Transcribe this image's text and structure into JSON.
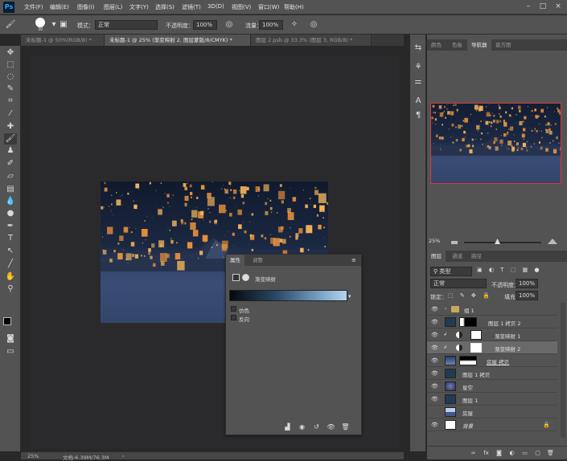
{
  "app": {
    "logo": "Ps"
  },
  "menu": [
    "文件(F)",
    "编辑(E)",
    "图像(I)",
    "图层(L)",
    "文字(Y)",
    "选择(S)",
    "滤镜(T)",
    "3D(D)",
    "视图(V)",
    "窗口(W)",
    "帮助(H)"
  ],
  "options": {
    "brush_size": "30",
    "mode_label": "模式：",
    "mode_value": "正常",
    "opacity_label": "不透明度：",
    "opacity_value": "100%",
    "flow_label": "流量：",
    "flow_value": "100%"
  },
  "tabs": [
    "未标题-1 @ 50%(RGB/8) *",
    "未标题-1 @ 25% (渐变映射 2, 图层蒙版/8/CMYK) *",
    "图层 2.psb @ 33.3% (图层 3, RGB/8) *"
  ],
  "status": {
    "zoom": "25%",
    "doc": "文档:6.39M/76.3M"
  },
  "properties": {
    "tab_props": "属性",
    "tab_adjust": "调整",
    "title": "渐变映射",
    "dither": "仿色",
    "reverse": "反向"
  },
  "right_panel": {
    "tabs": [
      "颜色",
      "色板",
      "导航器",
      "直方图"
    ],
    "nav_zoom": "25%"
  },
  "layers_panel": {
    "tabs": [
      "图层",
      "通道",
      "路径"
    ],
    "filter": "类型",
    "blend": "正常",
    "opacity_label": "不透明度：",
    "opacity": "100%",
    "lock_label": "锁定：",
    "fill_label": "填充：",
    "fill": "100%",
    "layers": [
      {
        "name": "组 1"
      },
      {
        "name": "图层 1 拷贝 2"
      },
      {
        "name": "渐变映射 1"
      },
      {
        "name": "渐变映射 2"
      },
      {
        "name": "房屋 拷贝"
      },
      {
        "name": "图层 1 拷贝"
      },
      {
        "name": "星空"
      },
      {
        "name": "图层 1"
      },
      {
        "name": "房屋"
      },
      {
        "name": "背景"
      }
    ]
  },
  "colors": {
    "accent_nav": "#d83a3a",
    "selected_row": "#6a6a6a"
  }
}
